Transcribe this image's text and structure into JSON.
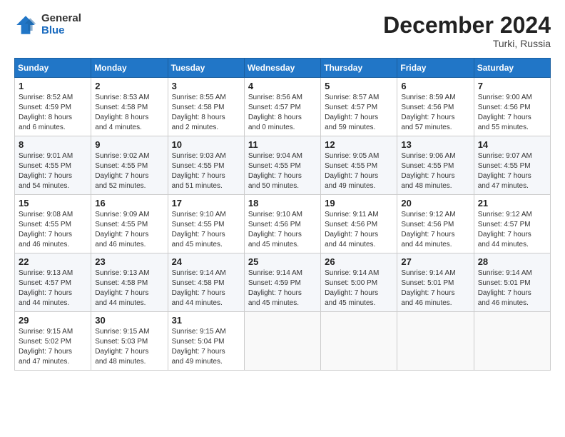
{
  "header": {
    "logo_general": "General",
    "logo_blue": "Blue",
    "month_title": "December 2024",
    "location": "Turki, Russia"
  },
  "calendar": {
    "days_of_week": [
      "Sunday",
      "Monday",
      "Tuesday",
      "Wednesday",
      "Thursday",
      "Friday",
      "Saturday"
    ],
    "weeks": [
      [
        {
          "day": "1",
          "sunrise": "8:52 AM",
          "sunset": "4:59 PM",
          "daylight": "8 hours and 6 minutes."
        },
        {
          "day": "2",
          "sunrise": "8:53 AM",
          "sunset": "4:58 PM",
          "daylight": "8 hours and 4 minutes."
        },
        {
          "day": "3",
          "sunrise": "8:55 AM",
          "sunset": "4:58 PM",
          "daylight": "8 hours and 2 minutes."
        },
        {
          "day": "4",
          "sunrise": "8:56 AM",
          "sunset": "4:57 PM",
          "daylight": "8 hours and 0 minutes."
        },
        {
          "day": "5",
          "sunrise": "8:57 AM",
          "sunset": "4:57 PM",
          "daylight": "7 hours and 59 minutes."
        },
        {
          "day": "6",
          "sunrise": "8:59 AM",
          "sunset": "4:56 PM",
          "daylight": "7 hours and 57 minutes."
        },
        {
          "day": "7",
          "sunrise": "9:00 AM",
          "sunset": "4:56 PM",
          "daylight": "7 hours and 55 minutes."
        }
      ],
      [
        {
          "day": "8",
          "sunrise": "9:01 AM",
          "sunset": "4:55 PM",
          "daylight": "7 hours and 54 minutes."
        },
        {
          "day": "9",
          "sunrise": "9:02 AM",
          "sunset": "4:55 PM",
          "daylight": "7 hours and 52 minutes."
        },
        {
          "day": "10",
          "sunrise": "9:03 AM",
          "sunset": "4:55 PM",
          "daylight": "7 hours and 51 minutes."
        },
        {
          "day": "11",
          "sunrise": "9:04 AM",
          "sunset": "4:55 PM",
          "daylight": "7 hours and 50 minutes."
        },
        {
          "day": "12",
          "sunrise": "9:05 AM",
          "sunset": "4:55 PM",
          "daylight": "7 hours and 49 minutes."
        },
        {
          "day": "13",
          "sunrise": "9:06 AM",
          "sunset": "4:55 PM",
          "daylight": "7 hours and 48 minutes."
        },
        {
          "day": "14",
          "sunrise": "9:07 AM",
          "sunset": "4:55 PM",
          "daylight": "7 hours and 47 minutes."
        }
      ],
      [
        {
          "day": "15",
          "sunrise": "9:08 AM",
          "sunset": "4:55 PM",
          "daylight": "7 hours and 46 minutes."
        },
        {
          "day": "16",
          "sunrise": "9:09 AM",
          "sunset": "4:55 PM",
          "daylight": "7 hours and 46 minutes."
        },
        {
          "day": "17",
          "sunrise": "9:10 AM",
          "sunset": "4:55 PM",
          "daylight": "7 hours and 45 minutes."
        },
        {
          "day": "18",
          "sunrise": "9:10 AM",
          "sunset": "4:56 PM",
          "daylight": "7 hours and 45 minutes."
        },
        {
          "day": "19",
          "sunrise": "9:11 AM",
          "sunset": "4:56 PM",
          "daylight": "7 hours and 44 minutes."
        },
        {
          "day": "20",
          "sunrise": "9:12 AM",
          "sunset": "4:56 PM",
          "daylight": "7 hours and 44 minutes."
        },
        {
          "day": "21",
          "sunrise": "9:12 AM",
          "sunset": "4:57 PM",
          "daylight": "7 hours and 44 minutes."
        }
      ],
      [
        {
          "day": "22",
          "sunrise": "9:13 AM",
          "sunset": "4:57 PM",
          "daylight": "7 hours and 44 minutes."
        },
        {
          "day": "23",
          "sunrise": "9:13 AM",
          "sunset": "4:58 PM",
          "daylight": "7 hours and 44 minutes."
        },
        {
          "day": "24",
          "sunrise": "9:14 AM",
          "sunset": "4:58 PM",
          "daylight": "7 hours and 44 minutes."
        },
        {
          "day": "25",
          "sunrise": "9:14 AM",
          "sunset": "4:59 PM",
          "daylight": "7 hours and 45 minutes."
        },
        {
          "day": "26",
          "sunrise": "9:14 AM",
          "sunset": "5:00 PM",
          "daylight": "7 hours and 45 minutes."
        },
        {
          "day": "27",
          "sunrise": "9:14 AM",
          "sunset": "5:01 PM",
          "daylight": "7 hours and 46 minutes."
        },
        {
          "day": "28",
          "sunrise": "9:14 AM",
          "sunset": "5:01 PM",
          "daylight": "7 hours and 46 minutes."
        }
      ],
      [
        {
          "day": "29",
          "sunrise": "9:15 AM",
          "sunset": "5:02 PM",
          "daylight": "7 hours and 47 minutes."
        },
        {
          "day": "30",
          "sunrise": "9:15 AM",
          "sunset": "5:03 PM",
          "daylight": "7 hours and 48 minutes."
        },
        {
          "day": "31",
          "sunrise": "9:15 AM",
          "sunset": "5:04 PM",
          "daylight": "7 hours and 49 minutes."
        },
        null,
        null,
        null,
        null
      ]
    ]
  }
}
